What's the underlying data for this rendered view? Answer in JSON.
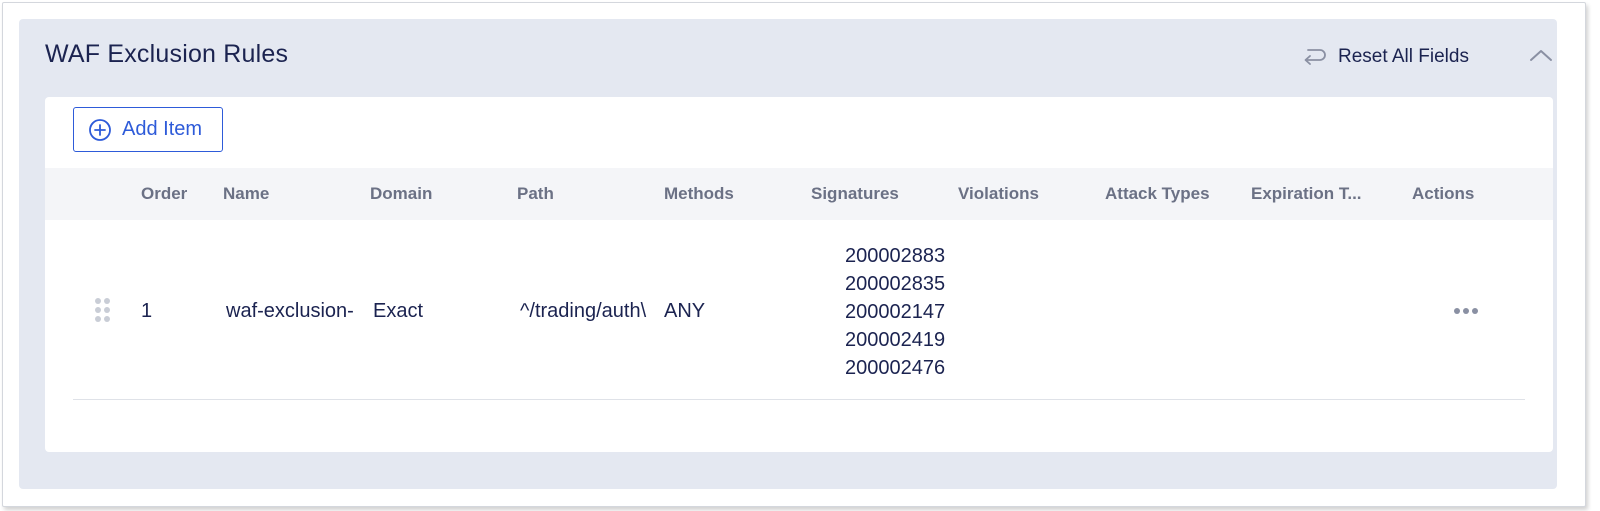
{
  "panel": {
    "title": "WAF Exclusion Rules",
    "reset_label": "Reset All Fields",
    "reset_icon": "undo-arrow-icon",
    "collapse_icon": "chevron-up-icon"
  },
  "toolbar": {
    "add_label": "Add Item",
    "add_icon": "plus-circle-icon"
  },
  "table": {
    "columns": [
      "Order",
      "Name",
      "Domain",
      "Path",
      "Methods",
      "Signatures",
      "Violations",
      "Attack Types",
      "Expiration T...",
      "Actions"
    ],
    "rows": [
      {
        "order": "1",
        "name": "waf-exclusion-",
        "domain": "Exact",
        "path": "^/trading/auth\\",
        "methods": "ANY",
        "signatures": [
          "200002883",
          "200002835",
          "200002147",
          "200002419",
          "200002476"
        ],
        "violations": "",
        "attack_types": "",
        "expiration": "",
        "actions_icon": "more-horizontal-icon"
      }
    ]
  },
  "colors": {
    "accent": "#2e5bd9",
    "panel_bg": "#e4e8f1",
    "header_bg": "#f4f5f8",
    "text": "#1b2350",
    "muted_text": "#6b7185"
  }
}
